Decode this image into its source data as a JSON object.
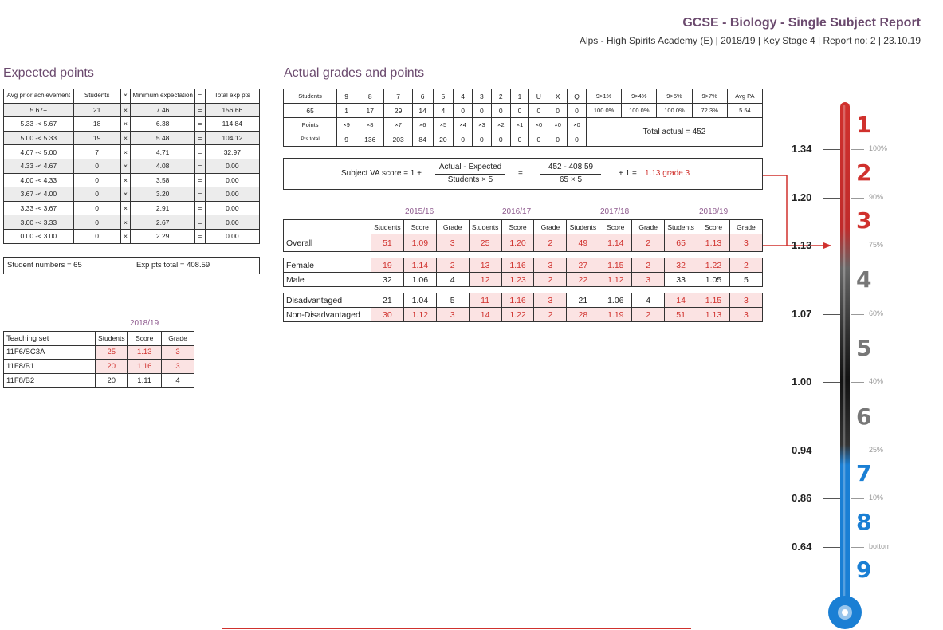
{
  "header": {
    "title": "GCSE - Biology - Single Subject Report",
    "subtitle": "Alps - High Spirits Academy (E) | 2018/19 | Key Stage 4 | Report no: 2 | 23.10.19"
  },
  "expected_points": {
    "title": "Expected points",
    "headers": [
      "Avg prior achievement",
      "Students",
      "×",
      "Minimum expectation",
      "=",
      "Total exp pts"
    ],
    "rows": [
      [
        "5.67+",
        "21",
        "×",
        "7.46",
        "=",
        "156.66"
      ],
      [
        "5.33 -< 5.67",
        "18",
        "×",
        "6.38",
        "=",
        "114.84"
      ],
      [
        "5.00 -< 5.33",
        "19",
        "×",
        "5.48",
        "=",
        "104.12"
      ],
      [
        "4.67 -< 5.00",
        "7",
        "×",
        "4.71",
        "=",
        "32.97"
      ],
      [
        "4.33 -< 4.67",
        "0",
        "×",
        "4.08",
        "=",
        "0.00"
      ],
      [
        "4.00 -< 4.33",
        "0",
        "×",
        "3.58",
        "=",
        "0.00"
      ],
      [
        "3.67 -< 4.00",
        "0",
        "×",
        "3.20",
        "=",
        "0.00"
      ],
      [
        "3.33 -< 3.67",
        "0",
        "×",
        "2.91",
        "=",
        "0.00"
      ],
      [
        "3.00 -< 3.33",
        "0",
        "×",
        "2.67",
        "=",
        "0.00"
      ],
      [
        "0.00 -< 3.00",
        "0",
        "×",
        "2.29",
        "=",
        "0.00"
      ]
    ],
    "student_numbers": "Student numbers = 65",
    "exp_pts_total": "Exp pts total = 408.59"
  },
  "teaching_set": {
    "year": "2018/19",
    "headers": [
      "Teaching set",
      "Students",
      "Score",
      "Grade"
    ],
    "rows": [
      {
        "cells": [
          "11F6/SC3A",
          "25",
          "1.13",
          "3"
        ],
        "highlight": true
      },
      {
        "cells": [
          "11F8/B1",
          "20",
          "1.16",
          "3"
        ],
        "highlight": true
      },
      {
        "cells": [
          "11F8/B2",
          "20",
          "1.11",
          "4"
        ],
        "highlight": false
      }
    ]
  },
  "actual": {
    "title": "Actual grades and points",
    "grade_headers": [
      "Students",
      "9",
      "8",
      "7",
      "6",
      "5",
      "4",
      "3",
      "2",
      "1",
      "U",
      "X",
      "Q"
    ],
    "grade_counts": [
      "65",
      "1",
      "17",
      "29",
      "14",
      "4",
      "0",
      "0",
      "0",
      "0",
      "0",
      "0",
      "0"
    ],
    "points_label": "Points",
    "points": [
      "×9",
      "×8",
      "×7",
      "×6",
      "×5",
      "×4",
      "×3",
      "×2",
      "×1",
      "×0",
      "×0",
      "×0"
    ],
    "pts_total_label": "Pts total",
    "pts_totals": [
      "9",
      "136",
      "203",
      "84",
      "20",
      "0",
      "0",
      "0",
      "0",
      "0",
      "0",
      "0"
    ],
    "pct_headers": [
      "9>1%",
      "9>4%",
      "9>5%",
      "9>7%",
      "Avg PA"
    ],
    "pct_values": [
      "100.0%",
      "100.0%",
      "100.0%",
      "72.3%",
      "5.54"
    ],
    "total_actual": "Total actual = 452"
  },
  "va": {
    "prefix": "Subject VA score = 1 +",
    "numerator": "Actual - Expected",
    "denominator": "Students × 5",
    "equals": "=",
    "num_value": "452 - 408.59",
    "den_value": "65 × 5",
    "suffix": "+ 1 =",
    "result": "1.13 grade 3"
  },
  "comparison": {
    "years": [
      "2015/16",
      "2016/17",
      "2017/18",
      "2018/19"
    ],
    "sub_headers": [
      "Students",
      "Score",
      "Grade"
    ],
    "rows": [
      {
        "label": "Overall",
        "values": [
          "51",
          "1.09",
          "3",
          "25",
          "1.20",
          "2",
          "49",
          "1.14",
          "2",
          "65",
          "1.13",
          "3"
        ],
        "pink": [
          true,
          true,
          true,
          true,
          true,
          true,
          true,
          true,
          true,
          true,
          true,
          true
        ]
      },
      {
        "label": "Female",
        "values": [
          "19",
          "1.14",
          "2",
          "13",
          "1.16",
          "3",
          "27",
          "1.15",
          "2",
          "32",
          "1.22",
          "2"
        ],
        "pink": [
          true,
          true,
          true,
          true,
          true,
          true,
          true,
          true,
          true,
          true,
          true,
          true
        ]
      },
      {
        "label": "Male",
        "values": [
          "32",
          "1.06",
          "4",
          "12",
          "1.23",
          "2",
          "22",
          "1.12",
          "3",
          "33",
          "1.05",
          "5"
        ],
        "pink": [
          false,
          false,
          false,
          true,
          true,
          true,
          true,
          true,
          true,
          false,
          false,
          false
        ]
      },
      {
        "label": "Disadvantaged",
        "values": [
          "21",
          "1.04",
          "5",
          "11",
          "1.16",
          "3",
          "21",
          "1.06",
          "4",
          "14",
          "1.15",
          "3"
        ],
        "pink": [
          false,
          false,
          false,
          true,
          true,
          true,
          false,
          false,
          false,
          true,
          true,
          true
        ]
      },
      {
        "label": "Non-Disadvantaged",
        "values": [
          "30",
          "1.12",
          "3",
          "14",
          "1.22",
          "2",
          "28",
          "1.19",
          "2",
          "51",
          "1.13",
          "3"
        ],
        "pink": [
          true,
          true,
          true,
          true,
          true,
          true,
          true,
          true,
          true,
          true,
          true,
          true
        ]
      }
    ]
  },
  "thermometer": {
    "grades": [
      {
        "label": "1",
        "color": "#d0312d"
      },
      {
        "label": "2",
        "color": "#d0312d"
      },
      {
        "label": "3",
        "color": "#d0312d"
      },
      {
        "label": "4",
        "color": "#777777"
      },
      {
        "label": "5",
        "color": "#777777"
      },
      {
        "label": "6",
        "color": "#777777"
      },
      {
        "label": "7",
        "color": "#1a7fd4"
      },
      {
        "label": "8",
        "color": "#1a7fd4"
      },
      {
        "label": "9",
        "color": "#1a7fd4"
      }
    ],
    "scale": [
      {
        "value": "1.34",
        "pct": "100%"
      },
      {
        "value": "1.20",
        "pct": "90%"
      },
      {
        "value": "1.13",
        "pct": "75%"
      },
      {
        "value": "1.07",
        "pct": "60%"
      },
      {
        "value": "1.00",
        "pct": "40%"
      },
      {
        "value": "0.94",
        "pct": "25%"
      },
      {
        "value": "0.86",
        "pct": "10%"
      },
      {
        "value": "0.64",
        "pct": "bottom"
      }
    ],
    "pointer_value": "1.13",
    "colors": {
      "red": "#d0312d",
      "grey": "#555555",
      "black": "#111111",
      "blue": "#1a7fd4"
    }
  }
}
